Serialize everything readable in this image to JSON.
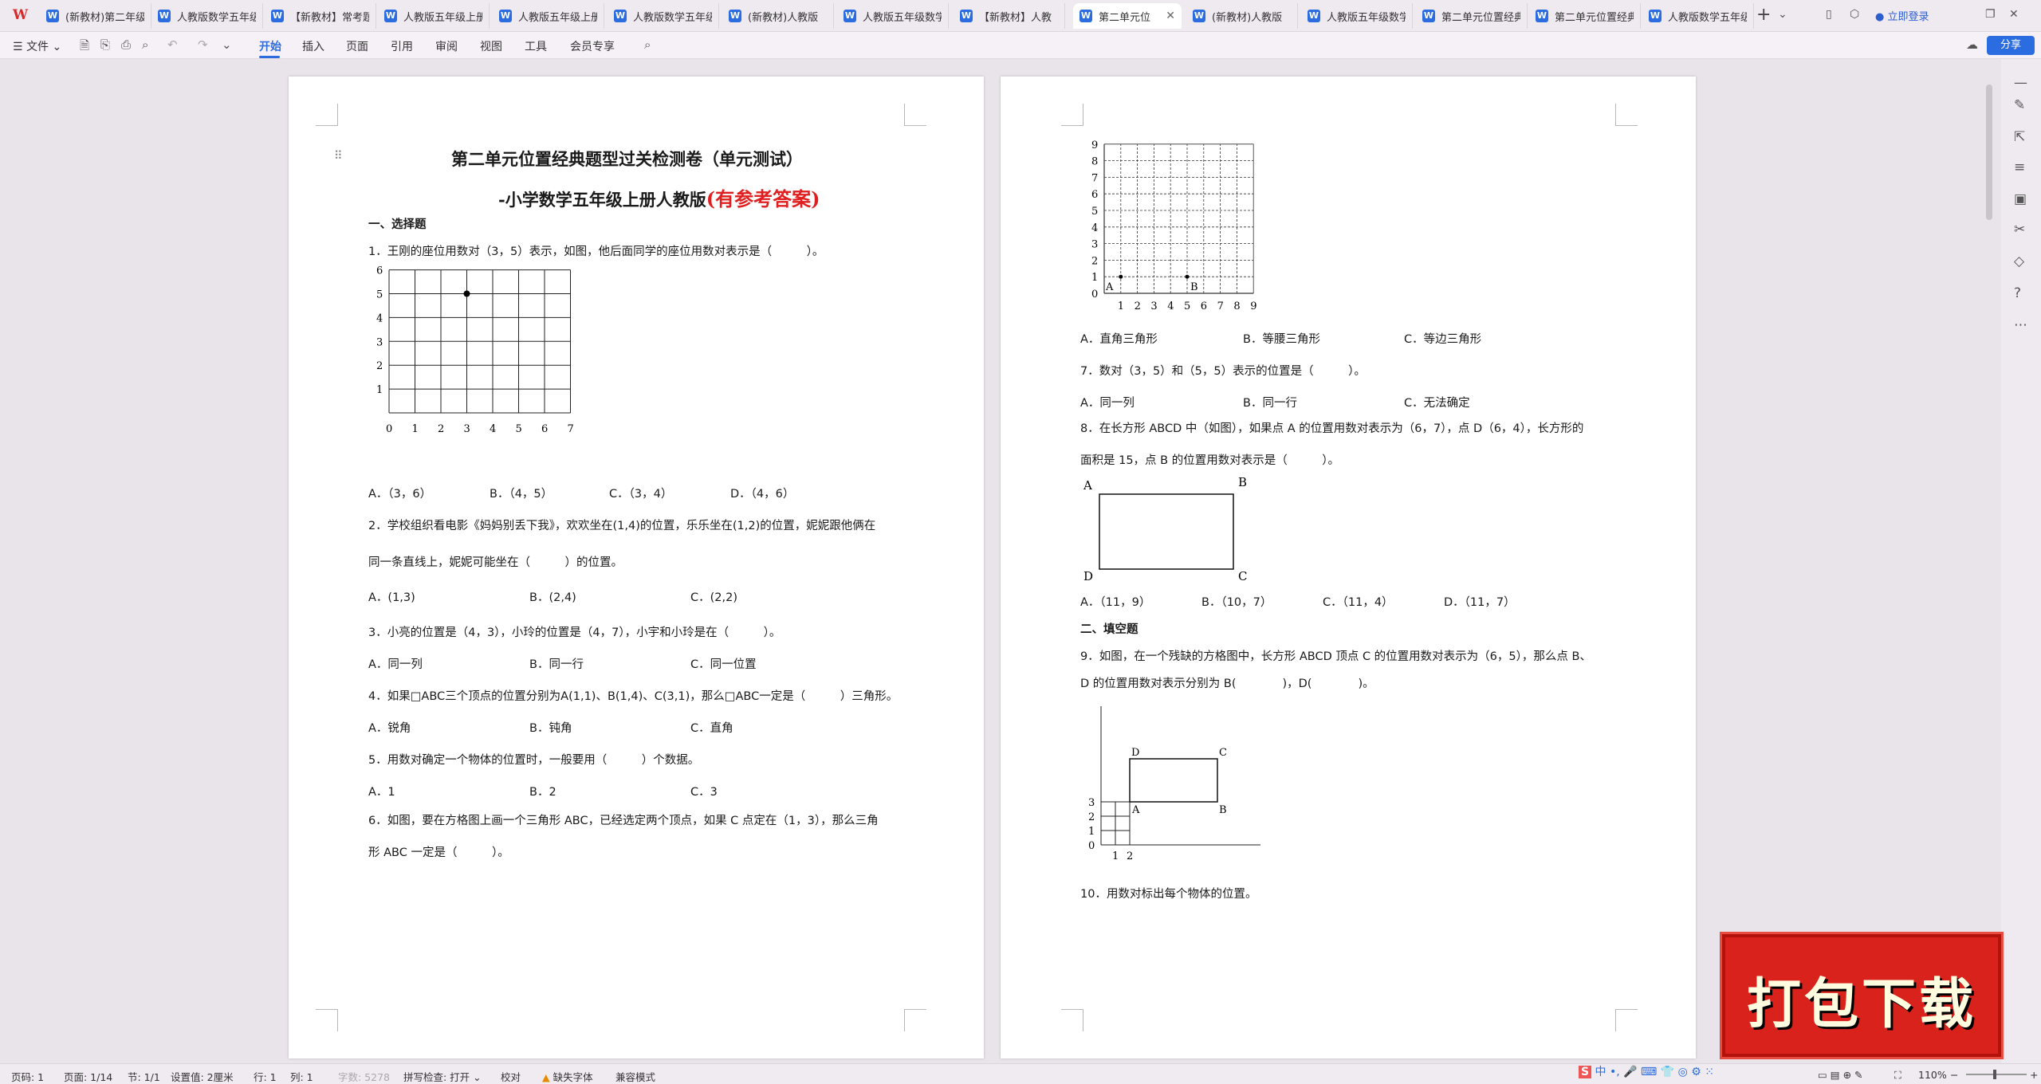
{
  "tabs": [
    "(新教材)第二年级",
    "人教版数学五年级",
    "【新教材】常考题",
    "人教版五年级上册",
    "人教版五年级上册",
    "人教版数学五年级",
    "(新教材)人教版",
    "人教版五年级数学",
    "【新教材】人教",
    "第二单元位",
    "(新教材)人教版",
    "人教版五年级数学",
    "第二单元位置经典",
    "第二单元位置经典",
    "人教版数学五年级"
  ],
  "login": "立即登录",
  "menu": {
    "file": "文件",
    "items": [
      "开始",
      "插入",
      "页面",
      "引用",
      "审阅",
      "视图",
      "工具",
      "会员专享"
    ],
    "share": "分享"
  },
  "doc": {
    "title1": "第二单元位置经典题型过关检测卷（单元测试）",
    "title2": "-小学数学五年级上册人教版",
    "title2_red": "(有参考答案)",
    "sec1": "一、选择题",
    "q1": "1．王刚的座位用数对（3，5）表示，如图，他后面同学的座位用数对表示是（　　　）。",
    "q1_opts": [
      "A．（3，6）",
      "B．（4，5）",
      "C．（3，4）",
      "D．（4，6）"
    ],
    "q2a": "2．学校组织看电影《妈妈别丢下我》，欢欢坐在(1,4)的位置，乐乐坐在(1,2)的位置，妮妮跟他俩在",
    "q2b": "同一条直线上，妮妮可能坐在（　　　）的位置。",
    "q2_opts": [
      "A．(1,3)",
      "B．(2,4)",
      "C．(2,2)"
    ],
    "q3": "3．小亮的位置是（4，3），小玲的位置是（4，7），小宇和小玲是在（　　　）。",
    "q3_opts": [
      "A．同一列",
      "B．同一行",
      "C．同一位置"
    ],
    "q4": "4．如果□ABC三个顶点的位置分别为A(1,1)、B(1,4)、C(3,1)，那么□ABC一定是（　　　）三角形。",
    "q4_opts": [
      "A．锐角",
      "B．钝角",
      "C．直角"
    ],
    "q5": "5．用数对确定一个物体的位置时，一般要用（　　　）个数据。",
    "q5_opts": [
      "A．1",
      "B．2",
      "C．3"
    ],
    "q6a": "6．如图，要在方格图上画一个三角形 ABC，已经选定两个顶点，如果 C 点定在（1，3），那么三角",
    "q6b": "形 ABC 一定是（　　　）。",
    "q6_opts": [
      "A．直角三角形",
      "B．等腰三角形",
      "C．等边三角形"
    ],
    "q7": "7．数对（3，5）和（5，5）表示的位置是（　　　）。",
    "q7_opts": [
      "A．同一列",
      "B．同一行",
      "C．无法确定"
    ],
    "q8a": "8．在长方形 ABCD 中（如图），如果点 A 的位置用数对表示为（6，7），点 D（6，4），长方形的",
    "q8b": "面积是 15，点 B 的位置用数对表示是（　　　）。",
    "q8_opts": [
      "A．（11，9）",
      "B．（10，7）",
      "C．（11，4）",
      "D．（11，7）"
    ],
    "sec2": "二、填空题",
    "q9a": "9．如图，在一个残缺的方格图中，长方形 ABCD 顶点 C 的位置用数对表示为（6，5），那么点 B、",
    "q9b": "D 的位置用数对表示分别为 B(　　　　)，D(　　　　)。",
    "q10": "10．用数对标出每个物体的位置。",
    "pt_A": "A",
    "pt_B": "B",
    "pt_C": "C",
    "pt_D": "D"
  },
  "grid1": {
    "xticks": [
      "0",
      "1",
      "2",
      "3",
      "4",
      "5",
      "6",
      "7"
    ],
    "yticks": [
      "1",
      "2",
      "3",
      "4",
      "5",
      "6"
    ],
    "point": [
      3,
      5
    ]
  },
  "grid2": {
    "xticks": [
      "1",
      "2",
      "3",
      "4",
      "5",
      "6",
      "7",
      "8",
      "9"
    ],
    "yticks": [
      "0",
      "1",
      "2",
      "3",
      "4",
      "5",
      "6",
      "7",
      "8",
      "9"
    ]
  },
  "grid3": {
    "xticks": [
      "1",
      "2"
    ],
    "yticks": [
      "0",
      "1",
      "2",
      "3"
    ]
  },
  "status": {
    "page": "页码: 1",
    "pages": "页面: 1/14",
    "section": "节: 1/1",
    "setting": "设置值: 2厘米",
    "row": "行: 1",
    "col": "列: 1",
    "words": "字数: 5278",
    "spell": "拼写检查: 打开",
    "proof": "校对",
    "font_missing": "缺失字体",
    "compat": "兼容模式",
    "zoom": "110%"
  },
  "promo": "打包下载"
}
